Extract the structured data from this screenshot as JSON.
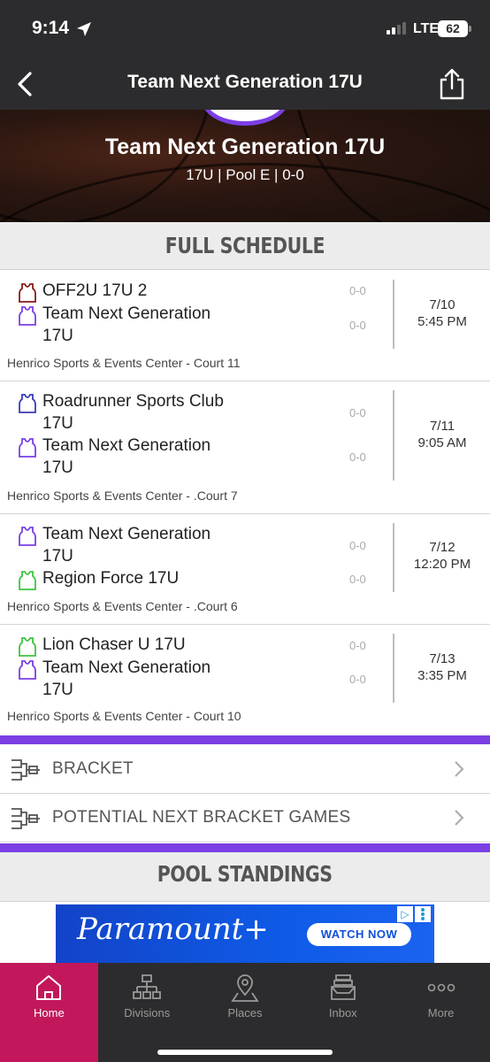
{
  "status_bar": {
    "time": "9:14",
    "network": "LTE",
    "battery": "62"
  },
  "nav": {
    "title": "Team Next Generation 17U"
  },
  "hero": {
    "title": "Team Next Generation 17U",
    "subtitle": "17U | Pool E | 0-0"
  },
  "schedule": {
    "header": "FULL SCHEDULE",
    "games": [
      {
        "team1": {
          "name": "OFF2U 17U 2",
          "score": "0-0",
          "jersey_color": "#8b1a1a"
        },
        "team2": {
          "name": "Team Next Generation 17U",
          "score": "0-0",
          "jersey_color": "#7b3fe4"
        },
        "date": "7/10",
        "time": "5:45 PM",
        "venue": "Henrico Sports & Events Center - Court 11"
      },
      {
        "team1": {
          "name": "Roadrunner Sports Club 17U",
          "score": "0-0",
          "jersey_color": "#3b3bb3"
        },
        "team2": {
          "name": "Team Next Generation 17U",
          "score": "0-0",
          "jersey_color": "#7b3fe4"
        },
        "date": "7/11",
        "time": "9:05 AM",
        "venue": "Henrico Sports & Events Center - .Court 7"
      },
      {
        "team1": {
          "name": "Team Next Generation 17U",
          "score": "0-0",
          "jersey_color": "#7b3fe4"
        },
        "team2": {
          "name": "Region Force 17U",
          "score": "0-0",
          "jersey_color": "#3ec43e"
        },
        "date": "7/12",
        "time": "12:20 PM",
        "venue": "Henrico Sports & Events Center - .Court 6"
      },
      {
        "team1": {
          "name": "Lion Chaser U 17U",
          "score": "0-0",
          "jersey_color": "#3ec43e"
        },
        "team2": {
          "name": "Team Next Generation 17U",
          "score": "0-0",
          "jersey_color": "#7b3fe4"
        },
        "date": "7/13",
        "time": "3:35 PM",
        "venue": "Henrico Sports & Events Center - Court 10"
      }
    ]
  },
  "menu": {
    "bracket_label": "BRACKET",
    "potential_label": "POTENTIAL NEXT BRACKET GAMES"
  },
  "standings": {
    "header": "POOL STANDINGS"
  },
  "ad": {
    "brand": "Paramount+",
    "cta": "WATCH NOW",
    "info_icon": "ad-choices-icon"
  },
  "tabs": [
    {
      "label": "Home",
      "icon": "home-icon",
      "active": true
    },
    {
      "label": "Divisions",
      "icon": "hierarchy-icon",
      "active": false
    },
    {
      "label": "Places",
      "icon": "map-pin-icon",
      "active": false
    },
    {
      "label": "Inbox",
      "icon": "inbox-icon",
      "active": false
    },
    {
      "label": "More",
      "icon": "more-icon",
      "active": false
    }
  ],
  "colors": {
    "accent_purple": "#7b3fe4",
    "active_tab": "#c2185b",
    "bar_dark": "#2c2c2e"
  }
}
